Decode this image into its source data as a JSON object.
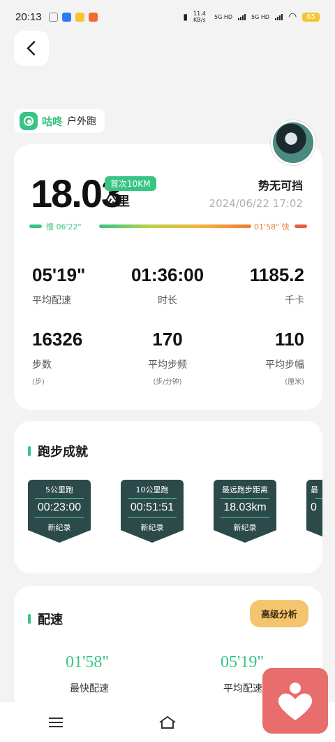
{
  "status_bar": {
    "time": "20:13",
    "net_speed": "11.4 KB/s",
    "sig1": "5G HD",
    "sig2": "5G HD",
    "battery": "65"
  },
  "brand": {
    "name": "咕咚",
    "sub": "户外跑"
  },
  "summary": {
    "distance": "18.03",
    "badge": "首次10KM",
    "unit": "公里",
    "username": "势无可挡",
    "date": "2024/06/22 17:02",
    "slow_label": "慢 06'22\"",
    "fast_label": "01'58\" 快"
  },
  "stats": [
    {
      "value": "05'19\"",
      "label": "平均配速",
      "unit": ""
    },
    {
      "value": "01:36:00",
      "label": "时长",
      "unit": ""
    },
    {
      "value": "1185.2",
      "label": "千卡",
      "unit": ""
    },
    {
      "value": "16326",
      "label": "步数",
      "unit": "(步)"
    },
    {
      "value": "170",
      "label": "平均步频",
      "unit": "(步/分钟)"
    },
    {
      "value": "110",
      "label": "平均步幅",
      "unit": "(厘米)"
    }
  ],
  "achievements": {
    "title": "跑步成就",
    "items": [
      {
        "title": "5公里跑",
        "value": "00:23:00",
        "record": "新纪录"
      },
      {
        "title": "10公里跑",
        "value": "00:51:51",
        "record": "新纪录"
      },
      {
        "title": "最远跑步距离",
        "value": "18.03km",
        "record": "新纪录"
      },
      {
        "title": "最",
        "value": "0",
        "record": ""
      }
    ]
  },
  "pace": {
    "title": "配速",
    "advanced_button": "高级分析",
    "fastest_value": "01'58\"",
    "fastest_label": "最快配速",
    "avg_value": "05'19\"",
    "avg_label": "平均配速"
  },
  "colors": {
    "accent": "#38c485",
    "badge_bg": "#2c4a4a",
    "warn": "#f07a3a"
  }
}
